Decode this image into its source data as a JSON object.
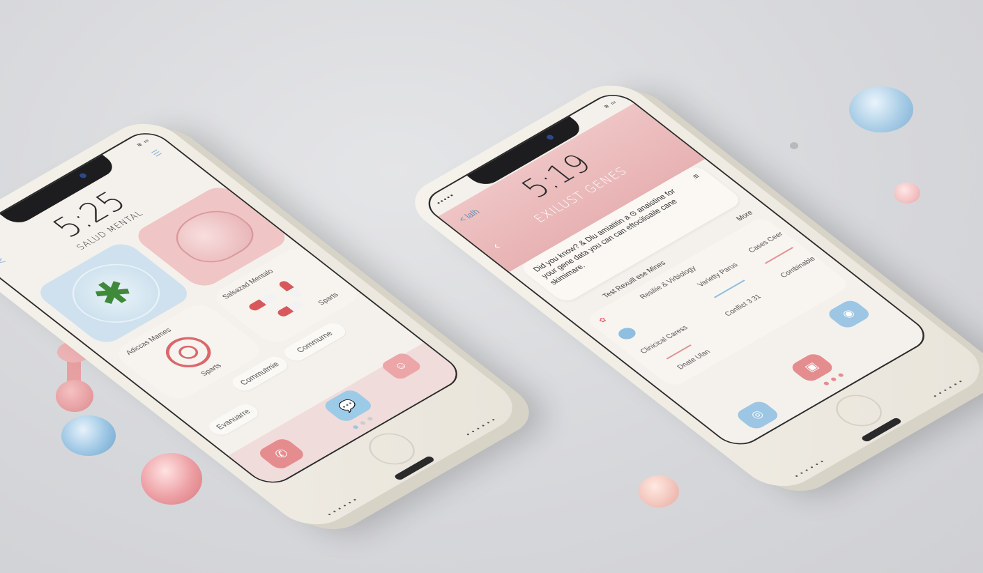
{
  "phone_left": {
    "status_left": "•••••",
    "time": "5:25",
    "title": "SALUD MENTAL",
    "back_label": "<",
    "card_mental": "Salsazad Mentalo",
    "card_mental_sub": "Sparts",
    "card_addiction": "Adiccas Mames",
    "card_addiction_sub": "Sparts",
    "chip_community_a": "Commurne",
    "chip_community_b": "Commutmie",
    "chip_evaluate": "Evanuarre"
  },
  "phone_right": {
    "status_left": "•••••",
    "back_label": "< lalh",
    "time": "5:19",
    "title": "EXILUST GENES",
    "fact_text": "Did you know? & Dlu amiatitin a ⊙ anaistine for your gene data you can can eftocilisaile cane skimimare.",
    "section_title": "Test Rexuill ese Mines",
    "more_label": "More",
    "row1_label": "Resiliie & Virbiology",
    "item_variety": "Varietty Parus",
    "item_cases": "Cases Ceer",
    "item_clinical": "Clinicical Caress",
    "item_conflict": "Conflict 3 31",
    "item_combinable": "Combinable",
    "item_data": "Dnate Ulan"
  },
  "colors": {
    "pink": "#e6a1a4",
    "blue": "#9cc6e4",
    "cream": "#f4f1ec"
  }
}
